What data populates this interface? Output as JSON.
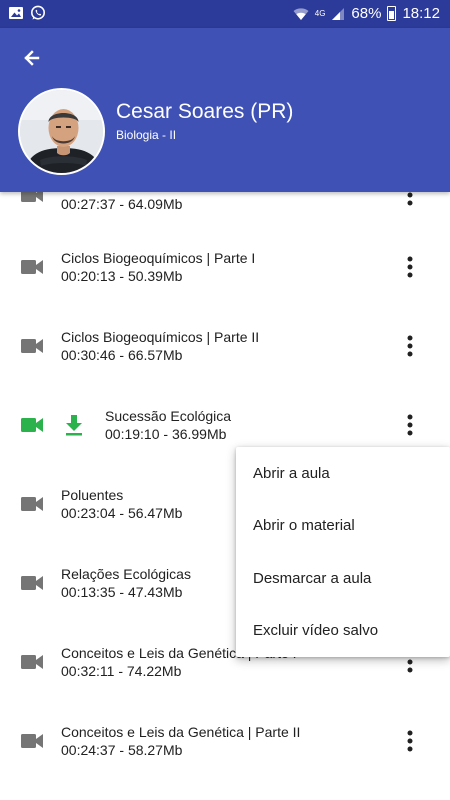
{
  "status_bar": {
    "time": "18:12",
    "battery": "68%",
    "network": "4G",
    "icons": [
      "image-icon",
      "whatsapp-icon",
      "wifi-icon",
      "signal-icon",
      "battery-icon"
    ]
  },
  "header": {
    "title": "Cesar Soares (PR)",
    "subtitle": "Biologia - II",
    "background_color": "#3f51b5",
    "status_color": "#2c3a99"
  },
  "lessons": [
    {
      "title": "",
      "meta": "00:27:37 - 64.09Mb",
      "downloaded": false
    },
    {
      "title": "Ciclos Biogeoquímicos | Parte I",
      "meta": "00:20:13 - 50.39Mb",
      "downloaded": false
    },
    {
      "title": "Ciclos Biogeoquímicos | Parte II",
      "meta": "00:30:46 - 66.57Mb",
      "downloaded": false
    },
    {
      "title": "Sucessão Ecológica",
      "meta": "00:19:10 - 36.99Mb",
      "downloaded": true
    },
    {
      "title": "Poluentes",
      "meta": "00:23:04 - 56.47Mb",
      "downloaded": false
    },
    {
      "title": "Relações Ecológicas",
      "meta": "00:13:35 - 47.43Mb",
      "downloaded": false
    },
    {
      "title": "Conceitos e Leis da Genética | Parte I",
      "meta": "00:32:11 - 74.22Mb",
      "downloaded": false
    },
    {
      "title": "Conceitos e Leis da Genética | Parte II",
      "meta": "00:24:37 - 58.27Mb",
      "downloaded": false
    }
  ],
  "context_menu": {
    "items": [
      "Abrir a aula",
      "Abrir o material",
      "Desmarcar a aula",
      "Excluir vídeo salvo"
    ]
  },
  "colors": {
    "downloaded_accent": "#2bb24c",
    "icon_grey": "#757575",
    "text_primary": "#212121"
  }
}
